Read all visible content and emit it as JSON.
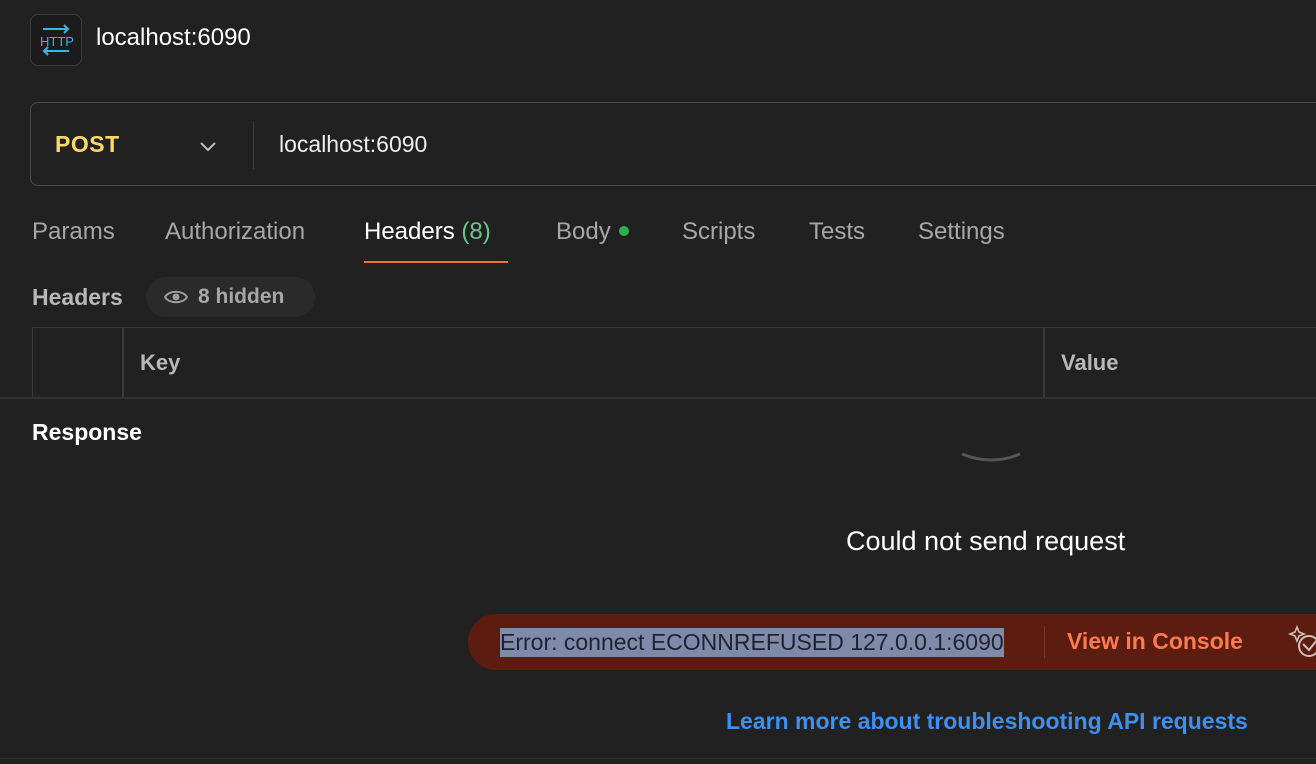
{
  "header": {
    "icon_text": "HTTP",
    "icon": "http-request-icon",
    "title": "localhost:6090"
  },
  "request": {
    "method": "POST",
    "url": "localhost:6090",
    "method_color": "#ffd866"
  },
  "tabs": [
    {
      "label": "Params"
    },
    {
      "label": "Authorization"
    },
    {
      "label": "Headers",
      "count": "(8)",
      "active": true
    },
    {
      "label": "Body",
      "indicator": "green-dot"
    },
    {
      "label": "Scripts"
    },
    {
      "label": "Tests"
    },
    {
      "label": "Settings"
    }
  ],
  "headers_section": {
    "label": "Headers",
    "hidden_badge": "8 hidden",
    "columns": {
      "key": "Key",
      "value": "Value"
    }
  },
  "response": {
    "title": "Response",
    "error_title": "Could not send request",
    "error_message": "Error: connect ECONNREFUSED 127.0.0.1:6090",
    "view_console": "View in Console",
    "learn_more": "Learn more about troubleshooting API requests"
  },
  "colors": {
    "accent": "#ff6c37",
    "error_banner": "#5c1d10",
    "link": "#3d8ff0",
    "count": "#6ec58a"
  }
}
